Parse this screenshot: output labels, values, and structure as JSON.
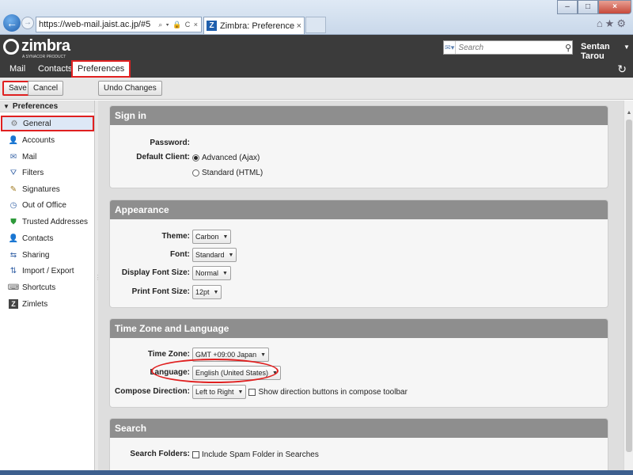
{
  "browser": {
    "url": "https://web-mail.jaist.ac.jp/#5",
    "url_icons": "⌕ ▾ ὑ2 C ×",
    "tab_title": "Zimbra: Preferences: G...",
    "tab_favicon": "Z",
    "tab_close": "×",
    "back": "←",
    "forward": "→",
    "win_minimize": "–",
    "win_maximize": "□",
    "win_close": "×",
    "right_icons": "⌂★⚙"
  },
  "header": {
    "logo_word": "zimbra",
    "logo_tagline": "A SYNACOR PRODUCT",
    "search_placeholder": "Search",
    "user_name": "Sentan Tarou"
  },
  "app_tabs": [
    {
      "label": "Mail"
    },
    {
      "label": "Contacts"
    },
    {
      "label": "Preferences",
      "active": true
    }
  ],
  "toolbar": {
    "save": "Save",
    "cancel": "Cancel",
    "undo": "Undo Changes"
  },
  "sidebar": {
    "heading": "Preferences",
    "items": [
      {
        "label": "General",
        "icon": "gear-icon",
        "active": true
      },
      {
        "label": "Accounts",
        "icon": "accounts-icon"
      },
      {
        "label": "Mail",
        "icon": "mail-icon"
      },
      {
        "label": "Filters",
        "icon": "filter-icon"
      },
      {
        "label": "Signatures",
        "icon": "signature-icon"
      },
      {
        "label": "Out of Office",
        "icon": "out-of-office-icon"
      },
      {
        "label": "Trusted Addresses",
        "icon": "shield-icon"
      },
      {
        "label": "Contacts",
        "icon": "contacts-icon"
      },
      {
        "label": "Sharing",
        "icon": "sharing-icon"
      },
      {
        "label": "Import / Export",
        "icon": "import-export-icon"
      },
      {
        "label": "Shortcuts",
        "icon": "shortcuts-icon"
      },
      {
        "label": "Zimlets",
        "icon": "zimlet-icon"
      }
    ]
  },
  "sign_in": {
    "title": "Sign in",
    "password_label": "Password:",
    "default_client_label": "Default Client:",
    "option_advanced": "Advanced (Ajax)",
    "option_standard": "Standard (HTML)"
  },
  "appearance": {
    "title": "Appearance",
    "theme_label": "Theme:",
    "theme_value": "Carbon",
    "font_label": "Font:",
    "font_value": "Standard",
    "display_font_size_label": "Display Font Size:",
    "display_font_size_value": "Normal",
    "print_font_size_label": "Print Font Size:",
    "print_font_size_value": "12pt"
  },
  "timezone": {
    "title": "Time Zone and Language",
    "tz_label": "Time Zone:",
    "tz_value": "GMT +09:00 Japan",
    "language_label": "Language:",
    "language_value": "English (United States)",
    "compose_direction_label": "Compose Direction:",
    "compose_direction_value": "Left to Right",
    "show_direction_label": "Show direction buttons in compose toolbar"
  },
  "search": {
    "title": "Search",
    "search_folders_label": "Search Folders:",
    "include_spam": "Include Spam Folder in Searches"
  },
  "colors": {
    "highlight": "#e02020",
    "header_bg": "#3b3b3b",
    "section_title_bg": "#8e8e8e"
  }
}
